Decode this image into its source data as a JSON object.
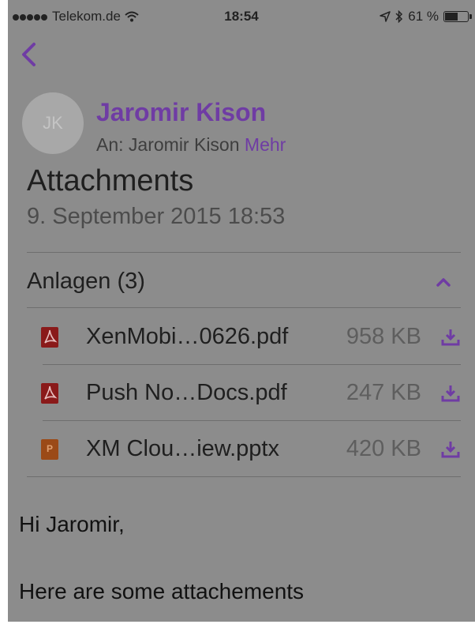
{
  "status": {
    "carrier": "Telekom.de",
    "time": "18:54",
    "battery": "61 %",
    "battery_level": 0.61
  },
  "nav": {
    "back_icon": "chevron-left-icon"
  },
  "message": {
    "avatar_initials": "JK",
    "sender": "Jaromir Kison",
    "recipient_prefix": "An: Jaromir Kison",
    "more_label": "Mehr",
    "subject": "Attachments",
    "date": "9. September 2015 18:53"
  },
  "attachments": {
    "header": "Anlagen (3)",
    "items": [
      {
        "name": "XenMobi…0626.pdf",
        "size": "958 KB",
        "type": "pdf"
      },
      {
        "name": "Push No…Docs.pdf",
        "size": "247 KB",
        "type": "pdf"
      },
      {
        "name": "XM Clou…iew.pptx",
        "size": "420 KB",
        "type": "pptx",
        "icon_letter": "P"
      }
    ]
  },
  "body": {
    "greeting": "Hi Jaromir,",
    "text": "Here are some attachements"
  },
  "colors": {
    "accent": "#6f3ca4",
    "overlay": "#8c8c8c"
  }
}
